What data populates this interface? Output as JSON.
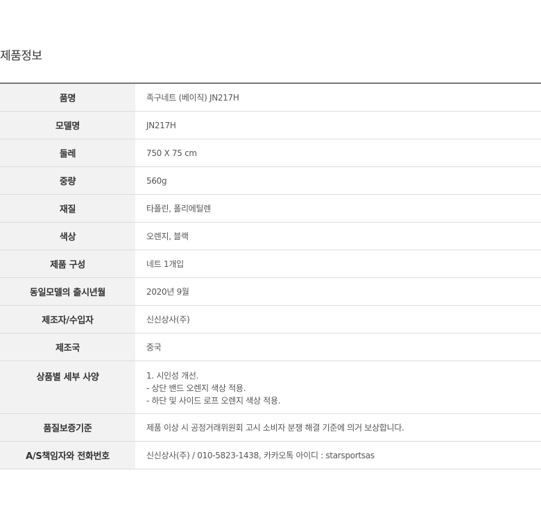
{
  "section": {
    "title": "제품정보"
  },
  "rows": [
    {
      "label": "품명",
      "value": "족구네트 (베이직) JN217H"
    },
    {
      "label": "모델명",
      "value": "JN217H"
    },
    {
      "label": "둘레",
      "value": "750 X 75 cm"
    },
    {
      "label": "중량",
      "value": "560g"
    },
    {
      "label": "재질",
      "value": "타폴린, 폴리에틸렌"
    },
    {
      "label": "색상",
      "value": "오렌지, 블랙"
    },
    {
      "label": "제품 구성",
      "value": "네트 1개입"
    },
    {
      "label": "동일모델의 출시년월",
      "value": "2020년 9월"
    },
    {
      "label": "제조자/수입자",
      "value": "신신상사(주)"
    },
    {
      "label": "제조국",
      "value": "중국"
    },
    {
      "label": "상품별 세부 사양",
      "lines": [
        "1. 시인성 개선.",
        "- 상단 밴드 오렌지 색상 적용.",
        "- 하단 및 사이드 로프 오렌지 색상 적용."
      ]
    },
    {
      "label": "품질보증기준",
      "value": "제품 이상 시 공정거래위원회 고시 소비자 분쟁 해결 기준에 의거 보상합니다."
    },
    {
      "label": "A/S책임자와 전화번호",
      "value": "신신상사(주) / 010-5823-1438, 카카오톡 아이디 : starsportsas"
    }
  ]
}
